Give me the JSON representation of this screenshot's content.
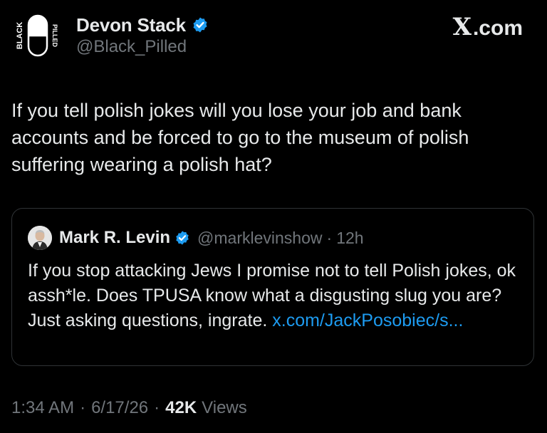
{
  "author": {
    "display_name": "Devon Stack",
    "handle": "@Black_Pilled",
    "avatar_text_left": "BLACK",
    "avatar_text_right": "PILLED",
    "verified_icon": "verified-badge-icon"
  },
  "site": {
    "mark": "X",
    "domain": ".com"
  },
  "tweet": {
    "text": "If you tell polish jokes will you lose your job and bank accounts and be forced to go to the museum of polish suffering wearing a polish hat?"
  },
  "quote": {
    "display_name": "Mark R. Levin",
    "handle": "@marklevinshow",
    "separator": "·",
    "time": "12h",
    "text": "If you stop attacking Jews I promise not to tell Polish jokes, ok assh*le. Does TPUSA know what a disgusting slug you are?  Just asking questions, ingrate. ",
    "link": "x.com/JackPosobiec/s..."
  },
  "meta": {
    "time": "1:34 AM",
    "separator": "·",
    "date": "6/17/26",
    "views_count": "42K",
    "views_label": "Views"
  },
  "colors": {
    "background": "#000000",
    "text_primary": "#e7e9ea",
    "text_secondary": "#71767b",
    "link": "#1d9bf0",
    "verified": "#1d9bf0",
    "border": "#2f3336"
  }
}
